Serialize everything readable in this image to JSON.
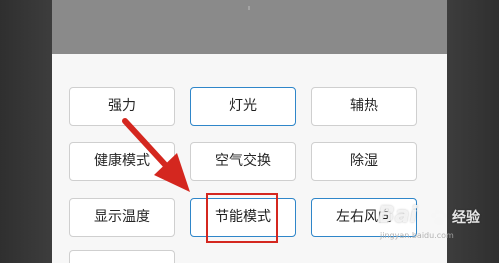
{
  "mode_buttons": {
    "strong": "强力",
    "light": "灯光",
    "aux_heat": "辅热",
    "health_mode": "健康模式",
    "air_exchange": "空气交换",
    "dehumidify": "除湿",
    "show_temperature": "显示温度",
    "energy_saving_mode": "节能模式",
    "left_right_swing": "左右风向"
  },
  "watermark": {
    "brand": "Bai",
    "brand_cn": "经验",
    "url": "jingyan.baidu.com"
  },
  "colors": {
    "header_gray": "#8a8a8a",
    "panel_bg": "#f7f7f7",
    "active_border": "#2f86c9",
    "annotation_red": "#d4271f"
  },
  "icons": {
    "annotation_arrow": "red-arrow-icon",
    "watermark_paw": "paw-icon"
  }
}
